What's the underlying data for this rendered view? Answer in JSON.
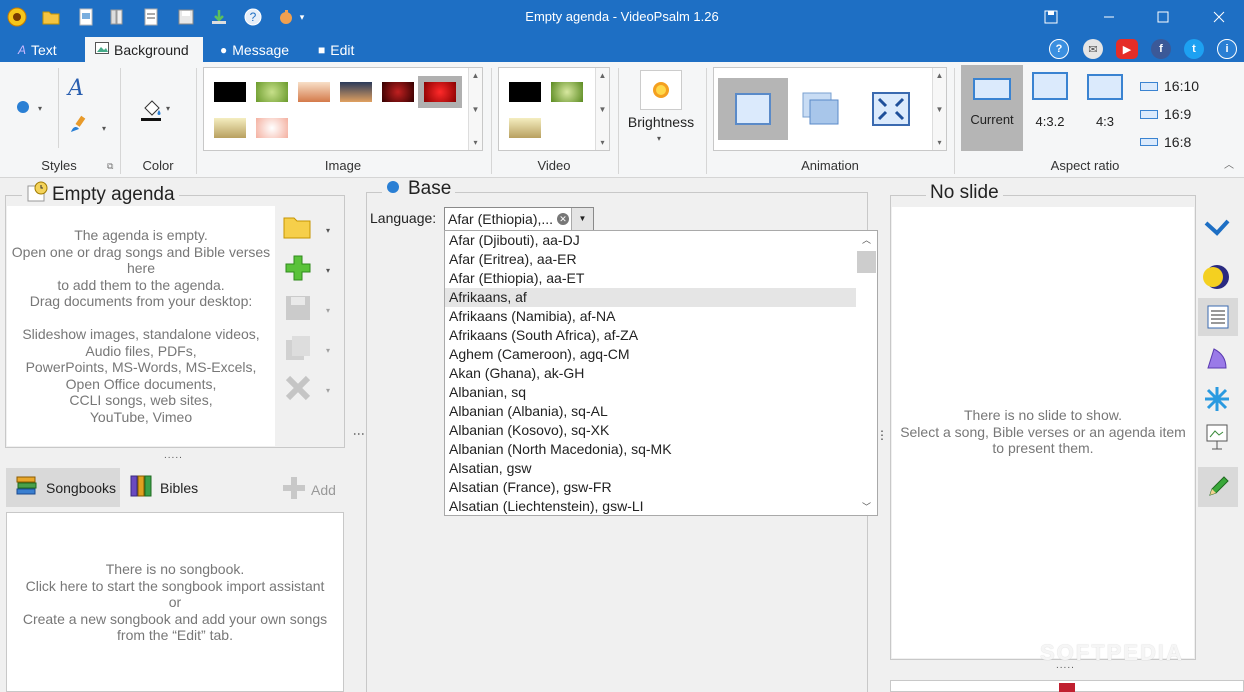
{
  "window": {
    "title": "Empty agenda - VideoPsalm 1.26"
  },
  "quick_access": [
    "sun-logo-icon",
    "folder-icon",
    "open-icon",
    "books-icon",
    "document-icon",
    "save-icon",
    "download-icon",
    "help-icon",
    "hand-icon"
  ],
  "tabs": [
    {
      "label": "Text",
      "icon": "text-icon"
    },
    {
      "label": "Background",
      "icon": "image-icon"
    },
    {
      "label": "Message",
      "icon": "message-icon"
    },
    {
      "label": "Edit",
      "icon": "edit-icon"
    }
  ],
  "ribbon": {
    "groups": {
      "styles": "Styles",
      "color": "Color",
      "image": "Image",
      "video": "Video",
      "animation": "Animation",
      "aspect_ratio": "Aspect ratio"
    },
    "brightness_label": "Brightness",
    "aspect_buttons": [
      "Current",
      "4:3.2",
      "4:3"
    ],
    "aspect_list": [
      "16:10",
      "16:9",
      "16:8"
    ]
  },
  "agenda": {
    "title": "Empty agenda",
    "lines": [
      "The agenda is empty.",
      "Open one or drag songs and Bible verses",
      "here",
      "to add them to the agenda.",
      "Drag documents from your desktop:",
      "",
      "Slideshow images, standalone videos,",
      "Audio files, PDFs,",
      "PowerPoints, MS-Words, MS-Excels,",
      "Open Office documents,",
      "CCLI songs, web sites,",
      "YouTube, Vimeo"
    ]
  },
  "songbooks": {
    "tab_songbooks": "Songbooks",
    "tab_bibles": "Bibles",
    "add_label": "Add",
    "lines": [
      "There is no songbook.",
      "Click here to start the songbook import assistant",
      "or",
      "Create a new songbook and add your own songs",
      "from the “Edit” tab."
    ]
  },
  "base": {
    "title": "Base",
    "language_label": "Language:",
    "language_value": "Afar (Ethiopia),...",
    "languages": [
      "Afar (Djibouti), aa-DJ",
      "Afar (Eritrea), aa-ER",
      "Afar (Ethiopia), aa-ET",
      "Afrikaans, af",
      "Afrikaans (Namibia), af-NA",
      "Afrikaans (South Africa), af-ZA",
      "Aghem (Cameroon), agq-CM",
      "Akan (Ghana), ak-GH",
      "Albanian, sq",
      "Albanian (Albania), sq-AL",
      "Albanian (Kosovo), sq-XK",
      "Albanian (North Macedonia), sq-MK",
      "Alsatian, gsw",
      "Alsatian (France), gsw-FR",
      "Alsatian (Liechtenstein), gsw-LI"
    ],
    "highlighted_index": 3
  },
  "slide": {
    "title": "No slide",
    "lines": [
      "There is no slide to show.",
      "Select a song, Bible verses or an agenda item",
      "to present them."
    ]
  },
  "watermark": "SOFTPEDIA",
  "colors": {
    "titlebar": "#1e6fc4",
    "accent": "#3a83d1"
  }
}
